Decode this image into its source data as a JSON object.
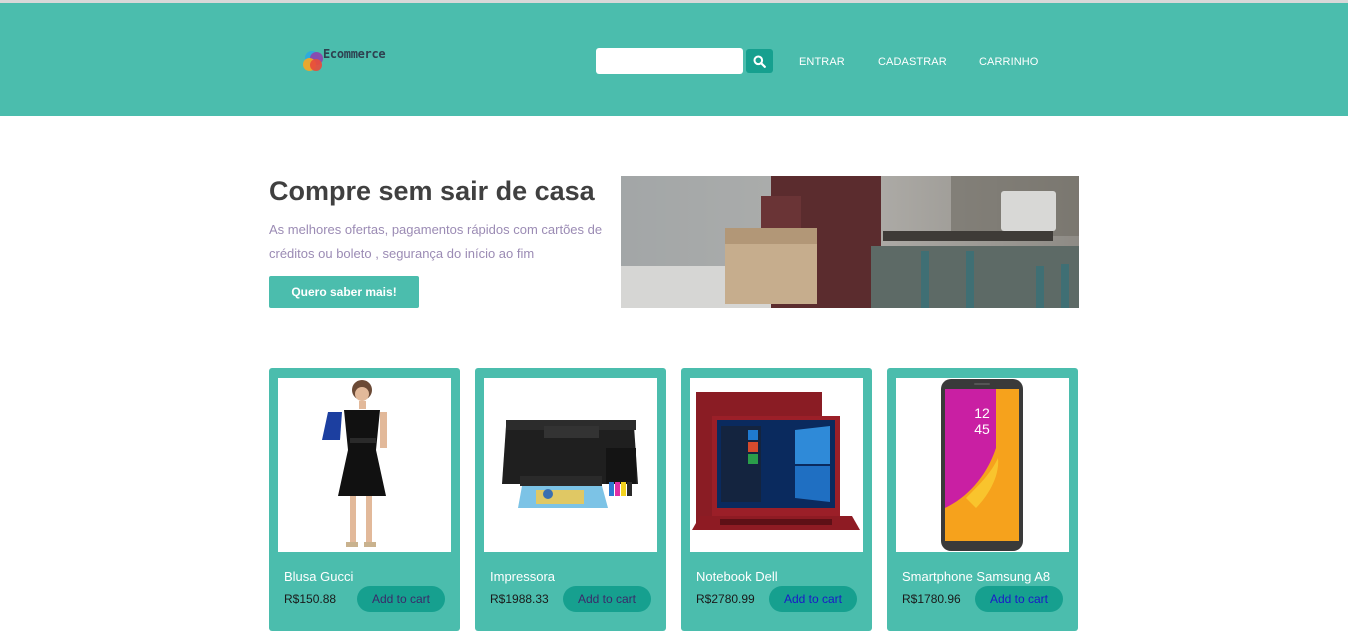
{
  "header": {
    "logo_text": "Ecommerce",
    "search": {
      "value": "",
      "placeholder": ""
    },
    "nav": [
      "ENTRAR",
      "CADASTRAR",
      "CARRINHO"
    ]
  },
  "hero": {
    "title": "Compre sem sair de casa",
    "subtitle": "As melhores ofertas, pagamentos rápidos com cartões de créditos ou boleto , segurança do início ao fim",
    "button": "Quero saber mais!"
  },
  "products": [
    {
      "name": "Blusa Gucci",
      "price": "R$150.88",
      "button": "Add to cart"
    },
    {
      "name": "Impressora",
      "price": "R$1988.33",
      "button": "Add to cart"
    },
    {
      "name": "Notebook Dell",
      "price": "R$2780.99",
      "button": "Add to cart"
    },
    {
      "name": "Smartphone Samsung A8",
      "price": "R$1780.96",
      "button": "Add to cart"
    }
  ],
  "colors": {
    "brand": "#4bbdad",
    "accent": "#16a08f",
    "title": "#404040",
    "subtitle": "#9b8bb4"
  }
}
